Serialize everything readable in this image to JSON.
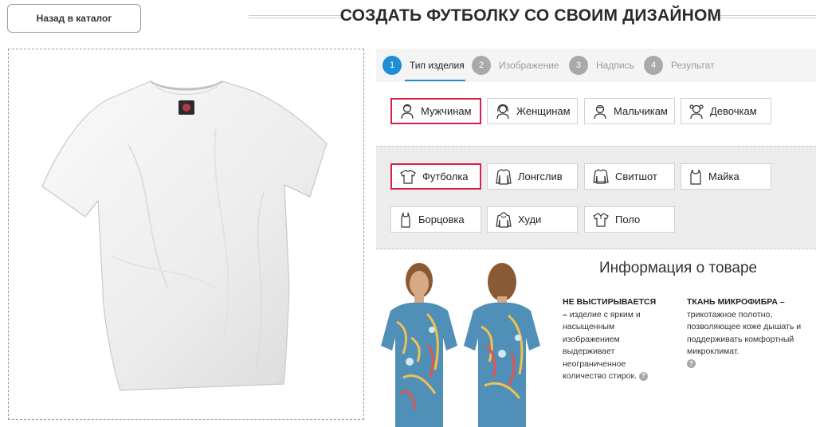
{
  "header": {
    "back_label": "Назад в каталог",
    "title": "СОЗДАТЬ ФУТБОЛКУ СО СВОИМ ДИЗАЙНОМ"
  },
  "steps": [
    {
      "num": "1",
      "label": "Тип изделия",
      "active": true
    },
    {
      "num": "2",
      "label": "Изображение",
      "active": false
    },
    {
      "num": "3",
      "label": "Надпись",
      "active": false
    },
    {
      "num": "4",
      "label": "Результат",
      "active": false
    }
  ],
  "audience": [
    {
      "label": "Мужчинам",
      "icon": "man-icon",
      "selected": true
    },
    {
      "label": "Женщинам",
      "icon": "woman-icon",
      "selected": false
    },
    {
      "label": "Мальчикам",
      "icon": "boy-icon",
      "selected": false
    },
    {
      "label": "Девочкам",
      "icon": "girl-icon",
      "selected": false
    }
  ],
  "product_types": [
    {
      "label": "Футболка",
      "icon": "tshirt-icon",
      "selected": true
    },
    {
      "label": "Лонгслив",
      "icon": "longsleeve-icon",
      "selected": false
    },
    {
      "label": "Свитшот",
      "icon": "sweatshirt-icon",
      "selected": false
    },
    {
      "label": "Майка",
      "icon": "tank-top-icon",
      "selected": false
    },
    {
      "label": "Борцовка",
      "icon": "racerback-icon",
      "selected": false
    },
    {
      "label": "Худи",
      "icon": "hoodie-icon",
      "selected": false
    },
    {
      "label": "Поло",
      "icon": "polo-icon",
      "selected": false
    }
  ],
  "info": {
    "title": "Информация о товаре",
    "feature1_heading": "НЕ ВЫСТИРЫВАЕТСЯ –",
    "feature1_text": "изделие с ярким и насыщенным изображением выдерживает неограниченное количество стирок.",
    "feature2_heading": "ТКАНЬ МИКРОФИБРА –",
    "feature2_text": "трикотажное полотно, позволяющее коже дышать и поддерживать комфортный микроклимат.",
    "help_glyph": "?"
  },
  "colors": {
    "accent_blue": "#1e8fd4",
    "selected_border": "#d81e4a",
    "step_inactive": "#a9a9a9"
  }
}
